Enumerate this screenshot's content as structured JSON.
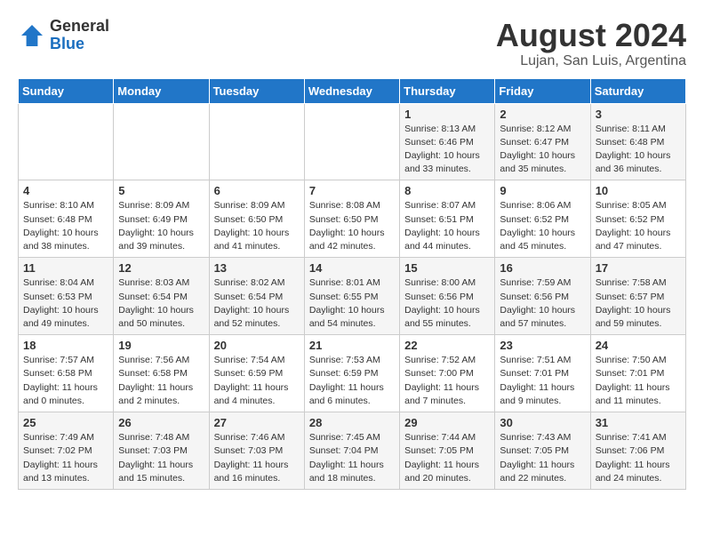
{
  "header": {
    "logo": {
      "general": "General",
      "blue": "Blue"
    },
    "month_year": "August 2024",
    "location": "Lujan, San Luis, Argentina"
  },
  "days_of_week": [
    "Sunday",
    "Monday",
    "Tuesday",
    "Wednesday",
    "Thursday",
    "Friday",
    "Saturday"
  ],
  "weeks": [
    [
      {
        "day": "",
        "info": ""
      },
      {
        "day": "",
        "info": ""
      },
      {
        "day": "",
        "info": ""
      },
      {
        "day": "",
        "info": ""
      },
      {
        "day": "1",
        "info": "Sunrise: 8:13 AM\nSunset: 6:46 PM\nDaylight: 10 hours\nand 33 minutes."
      },
      {
        "day": "2",
        "info": "Sunrise: 8:12 AM\nSunset: 6:47 PM\nDaylight: 10 hours\nand 35 minutes."
      },
      {
        "day": "3",
        "info": "Sunrise: 8:11 AM\nSunset: 6:48 PM\nDaylight: 10 hours\nand 36 minutes."
      }
    ],
    [
      {
        "day": "4",
        "info": "Sunrise: 8:10 AM\nSunset: 6:48 PM\nDaylight: 10 hours\nand 38 minutes."
      },
      {
        "day": "5",
        "info": "Sunrise: 8:09 AM\nSunset: 6:49 PM\nDaylight: 10 hours\nand 39 minutes."
      },
      {
        "day": "6",
        "info": "Sunrise: 8:09 AM\nSunset: 6:50 PM\nDaylight: 10 hours\nand 41 minutes."
      },
      {
        "day": "7",
        "info": "Sunrise: 8:08 AM\nSunset: 6:50 PM\nDaylight: 10 hours\nand 42 minutes."
      },
      {
        "day": "8",
        "info": "Sunrise: 8:07 AM\nSunset: 6:51 PM\nDaylight: 10 hours\nand 44 minutes."
      },
      {
        "day": "9",
        "info": "Sunrise: 8:06 AM\nSunset: 6:52 PM\nDaylight: 10 hours\nand 45 minutes."
      },
      {
        "day": "10",
        "info": "Sunrise: 8:05 AM\nSunset: 6:52 PM\nDaylight: 10 hours\nand 47 minutes."
      }
    ],
    [
      {
        "day": "11",
        "info": "Sunrise: 8:04 AM\nSunset: 6:53 PM\nDaylight: 10 hours\nand 49 minutes."
      },
      {
        "day": "12",
        "info": "Sunrise: 8:03 AM\nSunset: 6:54 PM\nDaylight: 10 hours\nand 50 minutes."
      },
      {
        "day": "13",
        "info": "Sunrise: 8:02 AM\nSunset: 6:54 PM\nDaylight: 10 hours\nand 52 minutes."
      },
      {
        "day": "14",
        "info": "Sunrise: 8:01 AM\nSunset: 6:55 PM\nDaylight: 10 hours\nand 54 minutes."
      },
      {
        "day": "15",
        "info": "Sunrise: 8:00 AM\nSunset: 6:56 PM\nDaylight: 10 hours\nand 55 minutes."
      },
      {
        "day": "16",
        "info": "Sunrise: 7:59 AM\nSunset: 6:56 PM\nDaylight: 10 hours\nand 57 minutes."
      },
      {
        "day": "17",
        "info": "Sunrise: 7:58 AM\nSunset: 6:57 PM\nDaylight: 10 hours\nand 59 minutes."
      }
    ],
    [
      {
        "day": "18",
        "info": "Sunrise: 7:57 AM\nSunset: 6:58 PM\nDaylight: 11 hours\nand 0 minutes."
      },
      {
        "day": "19",
        "info": "Sunrise: 7:56 AM\nSunset: 6:58 PM\nDaylight: 11 hours\nand 2 minutes."
      },
      {
        "day": "20",
        "info": "Sunrise: 7:54 AM\nSunset: 6:59 PM\nDaylight: 11 hours\nand 4 minutes."
      },
      {
        "day": "21",
        "info": "Sunrise: 7:53 AM\nSunset: 6:59 PM\nDaylight: 11 hours\nand 6 minutes."
      },
      {
        "day": "22",
        "info": "Sunrise: 7:52 AM\nSunset: 7:00 PM\nDaylight: 11 hours\nand 7 minutes."
      },
      {
        "day": "23",
        "info": "Sunrise: 7:51 AM\nSunset: 7:01 PM\nDaylight: 11 hours\nand 9 minutes."
      },
      {
        "day": "24",
        "info": "Sunrise: 7:50 AM\nSunset: 7:01 PM\nDaylight: 11 hours\nand 11 minutes."
      }
    ],
    [
      {
        "day": "25",
        "info": "Sunrise: 7:49 AM\nSunset: 7:02 PM\nDaylight: 11 hours\nand 13 minutes."
      },
      {
        "day": "26",
        "info": "Sunrise: 7:48 AM\nSunset: 7:03 PM\nDaylight: 11 hours\nand 15 minutes."
      },
      {
        "day": "27",
        "info": "Sunrise: 7:46 AM\nSunset: 7:03 PM\nDaylight: 11 hours\nand 16 minutes."
      },
      {
        "day": "28",
        "info": "Sunrise: 7:45 AM\nSunset: 7:04 PM\nDaylight: 11 hours\nand 18 minutes."
      },
      {
        "day": "29",
        "info": "Sunrise: 7:44 AM\nSunset: 7:05 PM\nDaylight: 11 hours\nand 20 minutes."
      },
      {
        "day": "30",
        "info": "Sunrise: 7:43 AM\nSunset: 7:05 PM\nDaylight: 11 hours\nand 22 minutes."
      },
      {
        "day": "31",
        "info": "Sunrise: 7:41 AM\nSunset: 7:06 PM\nDaylight: 11 hours\nand 24 minutes."
      }
    ]
  ]
}
